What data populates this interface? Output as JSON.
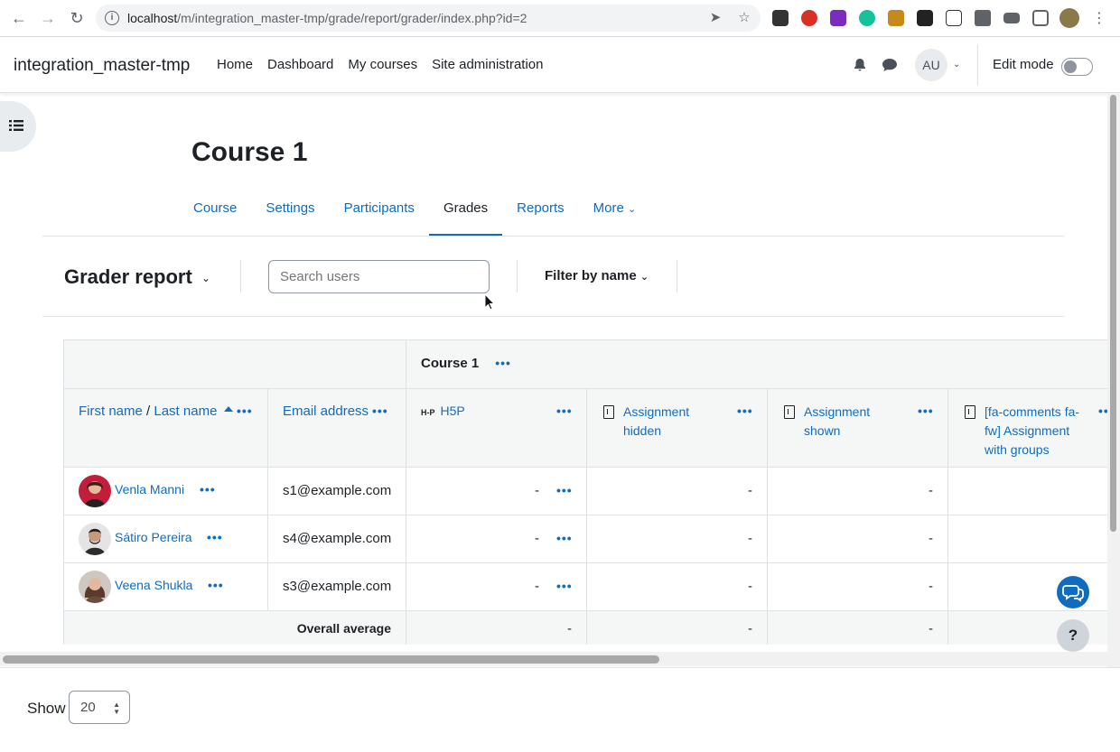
{
  "browser": {
    "url_host": "localhost",
    "url_path": "/m/integration_master-tmp/grade/report/grader/index.php?id=2"
  },
  "navbar": {
    "brand": "integration_master-tmp",
    "links": [
      "Home",
      "Dashboard",
      "My courses",
      "Site administration"
    ],
    "user_initials": "AU",
    "edit_mode_label": "Edit mode"
  },
  "course": {
    "title": "Course 1",
    "tabs": [
      "Course",
      "Settings",
      "Participants",
      "Grades",
      "Reports",
      "More"
    ],
    "active_tab": "Grades"
  },
  "report": {
    "title": "Grader report",
    "search_placeholder": "Search users",
    "filter_label": "Filter by name"
  },
  "grader": {
    "category": "Course 1",
    "name_header_first": "First name",
    "name_header_sep": " / ",
    "name_header_last": "Last name",
    "email_header": "Email address",
    "items": [
      "H5P",
      "Assignment hidden",
      "Assignment shown",
      "[fa-comments fa-fw] Assignment with groups"
    ],
    "rows": [
      {
        "name": "Venla Manni",
        "email": "s1@example.com",
        "grades": [
          "-",
          "-",
          "-",
          ""
        ]
      },
      {
        "name": "Sátiro Pereira",
        "email": "s4@example.com",
        "grades": [
          "-",
          "-",
          "-",
          ""
        ]
      },
      {
        "name": "Veena Shukla",
        "email": "s3@example.com",
        "grades": [
          "-",
          "-",
          "-",
          ""
        ]
      }
    ],
    "average_label": "Overall average",
    "averages": [
      "-",
      "-",
      "-",
      ""
    ]
  },
  "footer": {
    "show_label": "Show",
    "per_page": "20"
  },
  "help_label": "?"
}
